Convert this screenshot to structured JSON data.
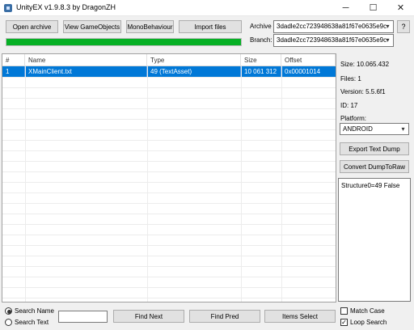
{
  "window": {
    "title": "UnityEX v1.9.8.3 by DragonZH",
    "minimize": "─",
    "maximize": "☐",
    "close": "✕"
  },
  "toolbar": {
    "open_archive": "Open archive",
    "view_gameobjects": "View GameObjects",
    "monobehaviour": "MonoBehaviour",
    "import_files": "Import files",
    "progress_fraction": 1.0
  },
  "archive": {
    "label": "Archive",
    "value": "3dadle2cc723948638a81f67e0635e9c"
  },
  "branch": {
    "label": "Branch:",
    "value": "3dadle2cc723948638a81f67e0635e9c"
  },
  "help_button": "?",
  "table": {
    "columns": [
      "#",
      "Name",
      "Type",
      "Size",
      "Offset"
    ],
    "rows": [
      {
        "num": "1",
        "name": "XMainClient.txt",
        "type": "49 (TextAsset)",
        "size": "10 061 312",
        "offset": "0x00001014"
      }
    ]
  },
  "info": {
    "size": "Size: 10.065.432",
    "files": "Files: 1",
    "version": "Version: 5.5.6f1",
    "id": "ID: 17",
    "platform_label": "Platform:",
    "platform_value": "ANDROID"
  },
  "actions": {
    "export_text_dump": "Export Text Dump",
    "convert_dump": "Convert DumpToRaw"
  },
  "details_text": "Structure0=49 False",
  "search": {
    "search_name": "Search Name",
    "search_text": "Search Text",
    "input_value": "",
    "find_next": "Find Next",
    "find_pred": "Find Pred",
    "items_select": "Items Select",
    "match_case": "Match Case",
    "loop_search": "Loop Search",
    "loop_mark": "✓"
  }
}
